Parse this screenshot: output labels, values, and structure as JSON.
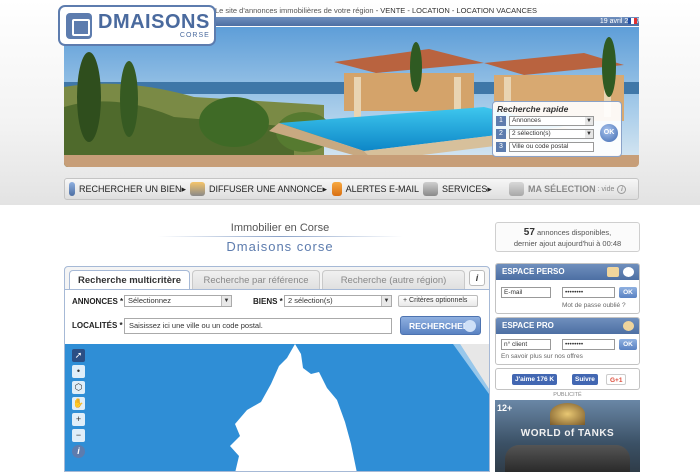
{
  "header": {
    "tagline": "Le site d'annonces immobilières de votre région",
    "tagline_links": "- VENTE - LOCATION - LOCATION VACANCES",
    "date": "19 avril 2017",
    "logo_name": "DMAISONS",
    "logo_sub": "CORSE"
  },
  "quick_search": {
    "title": "Recherche rapide",
    "rows": [
      {
        "num": "1",
        "value": "Annonces"
      },
      {
        "num": "2",
        "value": "2 sélection(s)"
      },
      {
        "num": "3",
        "value": "Ville ou code postal"
      }
    ],
    "ok": "OK"
  },
  "nav": {
    "items": [
      {
        "label": "RECHERCHER UN BIEN"
      },
      {
        "label": "DIFFUSER UNE ANNONCE"
      },
      {
        "label": "ALERTES E-MAIL"
      },
      {
        "label": "SERVICES"
      },
      {
        "label": "MA SÉLECTION",
        "suffix": ": vide"
      }
    ]
  },
  "heading": {
    "title": "Immobilier en Corse",
    "brand": "Dmaisons corse"
  },
  "stats": {
    "count": "57",
    "line1": "annonces disponibles,",
    "line2": "dernier ajout aujourd'hui à 00:48"
  },
  "search": {
    "tabs": [
      "Recherche multicritère",
      "Recherche par référence",
      "Recherche (autre région)"
    ],
    "info": "i",
    "annonces_label": "ANNONCES *",
    "annonces_value": "Sélectionnez",
    "biens_label": "BIENS *",
    "biens_value": "2 sélection(s)",
    "criteres": "+ Critères optionnels",
    "localites_label": "LOCALITÉS *",
    "localites_placeholder": "Saisissez ici une ville ou un code postal.",
    "search_button": "RECHERCHER"
  },
  "espace_perso": {
    "title": "ESPACE PERSO",
    "email_value": "E-mail",
    "password_value": "••••••••",
    "ok": "OK",
    "forgot": "Mot de passe oublié ?"
  },
  "espace_pro": {
    "title": "ESPACE PRO",
    "client_value": "n° client",
    "password_value": "••••••••",
    "ok": "OK",
    "more": "En savoir plus sur nos offres"
  },
  "social": {
    "like": "J'aime 176 K",
    "follow": "Suivre",
    "gplus": "G+1"
  },
  "ad": {
    "label": "PUBLICITÉ",
    "age": "12+",
    "logo": "WORLD of TANKS"
  },
  "colors": {
    "brand": "#5d7cae",
    "map_sea": "#2f8ed6"
  }
}
